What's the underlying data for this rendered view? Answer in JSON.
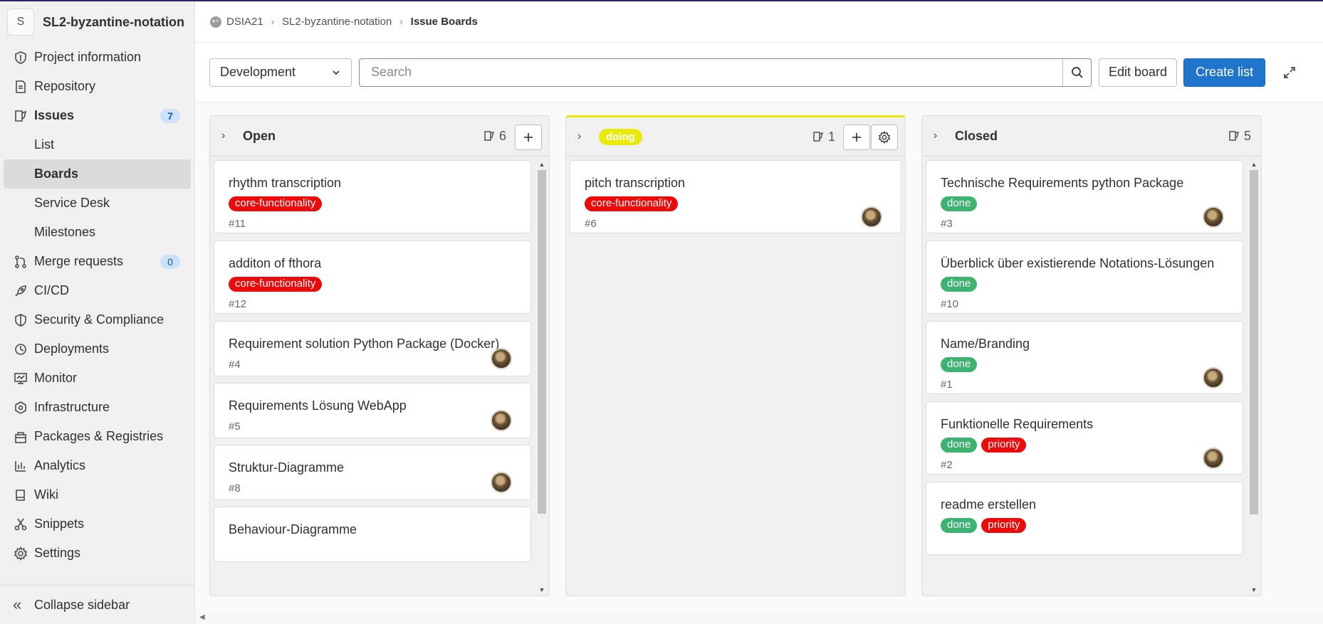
{
  "sidebar": {
    "avatar_letter": "S",
    "project_name": "SL2-byzantine-notation",
    "items": [
      {
        "label": "Project information",
        "icon": "project-info-icon"
      },
      {
        "label": "Repository",
        "icon": "repository-icon"
      },
      {
        "label": "Issues",
        "icon": "issues-icon",
        "badge": "7"
      },
      {
        "label": "Merge requests",
        "icon": "merge-request-icon",
        "badge": "0"
      },
      {
        "label": "CI/CD",
        "icon": "rocket-icon"
      },
      {
        "label": "Security & Compliance",
        "icon": "shield-icon"
      },
      {
        "label": "Deployments",
        "icon": "deployments-icon"
      },
      {
        "label": "Monitor",
        "icon": "monitor-icon"
      },
      {
        "label": "Infrastructure",
        "icon": "infrastructure-icon"
      },
      {
        "label": "Packages & Registries",
        "icon": "package-icon"
      },
      {
        "label": "Analytics",
        "icon": "analytics-icon"
      },
      {
        "label": "Wiki",
        "icon": "book-icon"
      },
      {
        "label": "Snippets",
        "icon": "scissors-icon"
      },
      {
        "label": "Settings",
        "icon": "gear-icon"
      }
    ],
    "issues_sub": [
      "List",
      "Boards",
      "Service Desk",
      "Milestones"
    ],
    "collapse_label": "Collapse sidebar"
  },
  "breadcrumb": {
    "group": "DSIA21",
    "project": "SL2-byzantine-notation",
    "current": "Issue Boards"
  },
  "toolbar": {
    "board_name": "Development",
    "search_placeholder": "Search",
    "edit_board": "Edit board",
    "create_list": "Create list"
  },
  "lists": {
    "open": {
      "title": "Open",
      "count": "6",
      "cards": [
        {
          "title": "rhythm transcription",
          "labels": [
            "core-functionality"
          ],
          "number": "#11",
          "avatar": false
        },
        {
          "title": "additon of fthora",
          "labels": [
            "core-functionality"
          ],
          "number": "#12",
          "avatar": false
        },
        {
          "title": "Requirement solution Python Package (Docker)",
          "labels": [],
          "number": "#4",
          "avatar": true
        },
        {
          "title": "Requirements Lösung WebApp",
          "labels": [],
          "number": "#5",
          "avatar": true
        },
        {
          "title": "Struktur-Diagramme",
          "labels": [],
          "number": "#8",
          "avatar": true
        },
        {
          "title": "Behaviour-Diagramme",
          "labels": [],
          "number": "",
          "avatar": false
        }
      ]
    },
    "doing": {
      "title": "doing",
      "count": "1",
      "cards": [
        {
          "title": "pitch transcription",
          "labels": [
            "core-functionality"
          ],
          "number": "#6",
          "avatar": true
        }
      ]
    },
    "closed": {
      "title": "Closed",
      "count": "5",
      "cards": [
        {
          "title": "Technische Requirements python Package",
          "labels": [
            "done"
          ],
          "number": "#3",
          "avatar": true
        },
        {
          "title": "Überblick über existierende Notations-Lösungen",
          "labels": [
            "done"
          ],
          "number": "#10",
          "avatar": false
        },
        {
          "title": "Name/Branding",
          "labels": [
            "done"
          ],
          "number": "#1",
          "avatar": true
        },
        {
          "title": "Funktionelle Requirements",
          "labels": [
            "done",
            "priority"
          ],
          "number": "#2",
          "avatar": true
        },
        {
          "title": "readme erstellen",
          "labels": [
            "done",
            "priority"
          ],
          "number": "",
          "avatar": false
        }
      ]
    }
  },
  "label_colors": {
    "core-functionality": "#ec0a0a",
    "done": "#3cb371",
    "priority": "#ec0a0a",
    "doing": "#e9e90a"
  },
  "colors": {
    "primary_button": "#1f75cb",
    "badge_bg": "#cbe2f9",
    "sidebar_bg": "#f0f0f0"
  }
}
